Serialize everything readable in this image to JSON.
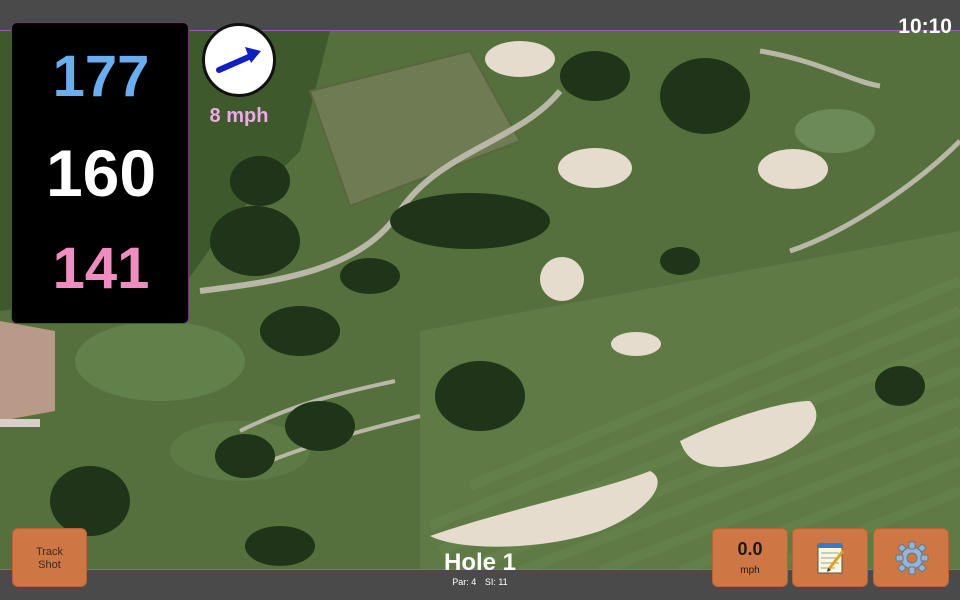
{
  "status": {
    "time": "10:10"
  },
  "distances": {
    "back": "177",
    "middle": "160",
    "front": "141"
  },
  "wind": {
    "speed_label": "8 mph",
    "direction_icon": "arrow-icon"
  },
  "hole": {
    "title": "Hole 1",
    "par": "Par: 4",
    "si": "SI: 11"
  },
  "buttons": {
    "track_shot": "Track\nShot",
    "wind_value": "0.0",
    "wind_unit": "mph",
    "notes_icon": "notepad-icon",
    "settings_icon": "gear-icon"
  },
  "colors": {
    "back_distance": "#6aaef0",
    "middle_distance": "#ffffff",
    "front_distance": "#f08cc0",
    "button": "#cf7744",
    "wind_text": "#f0a8e8"
  }
}
